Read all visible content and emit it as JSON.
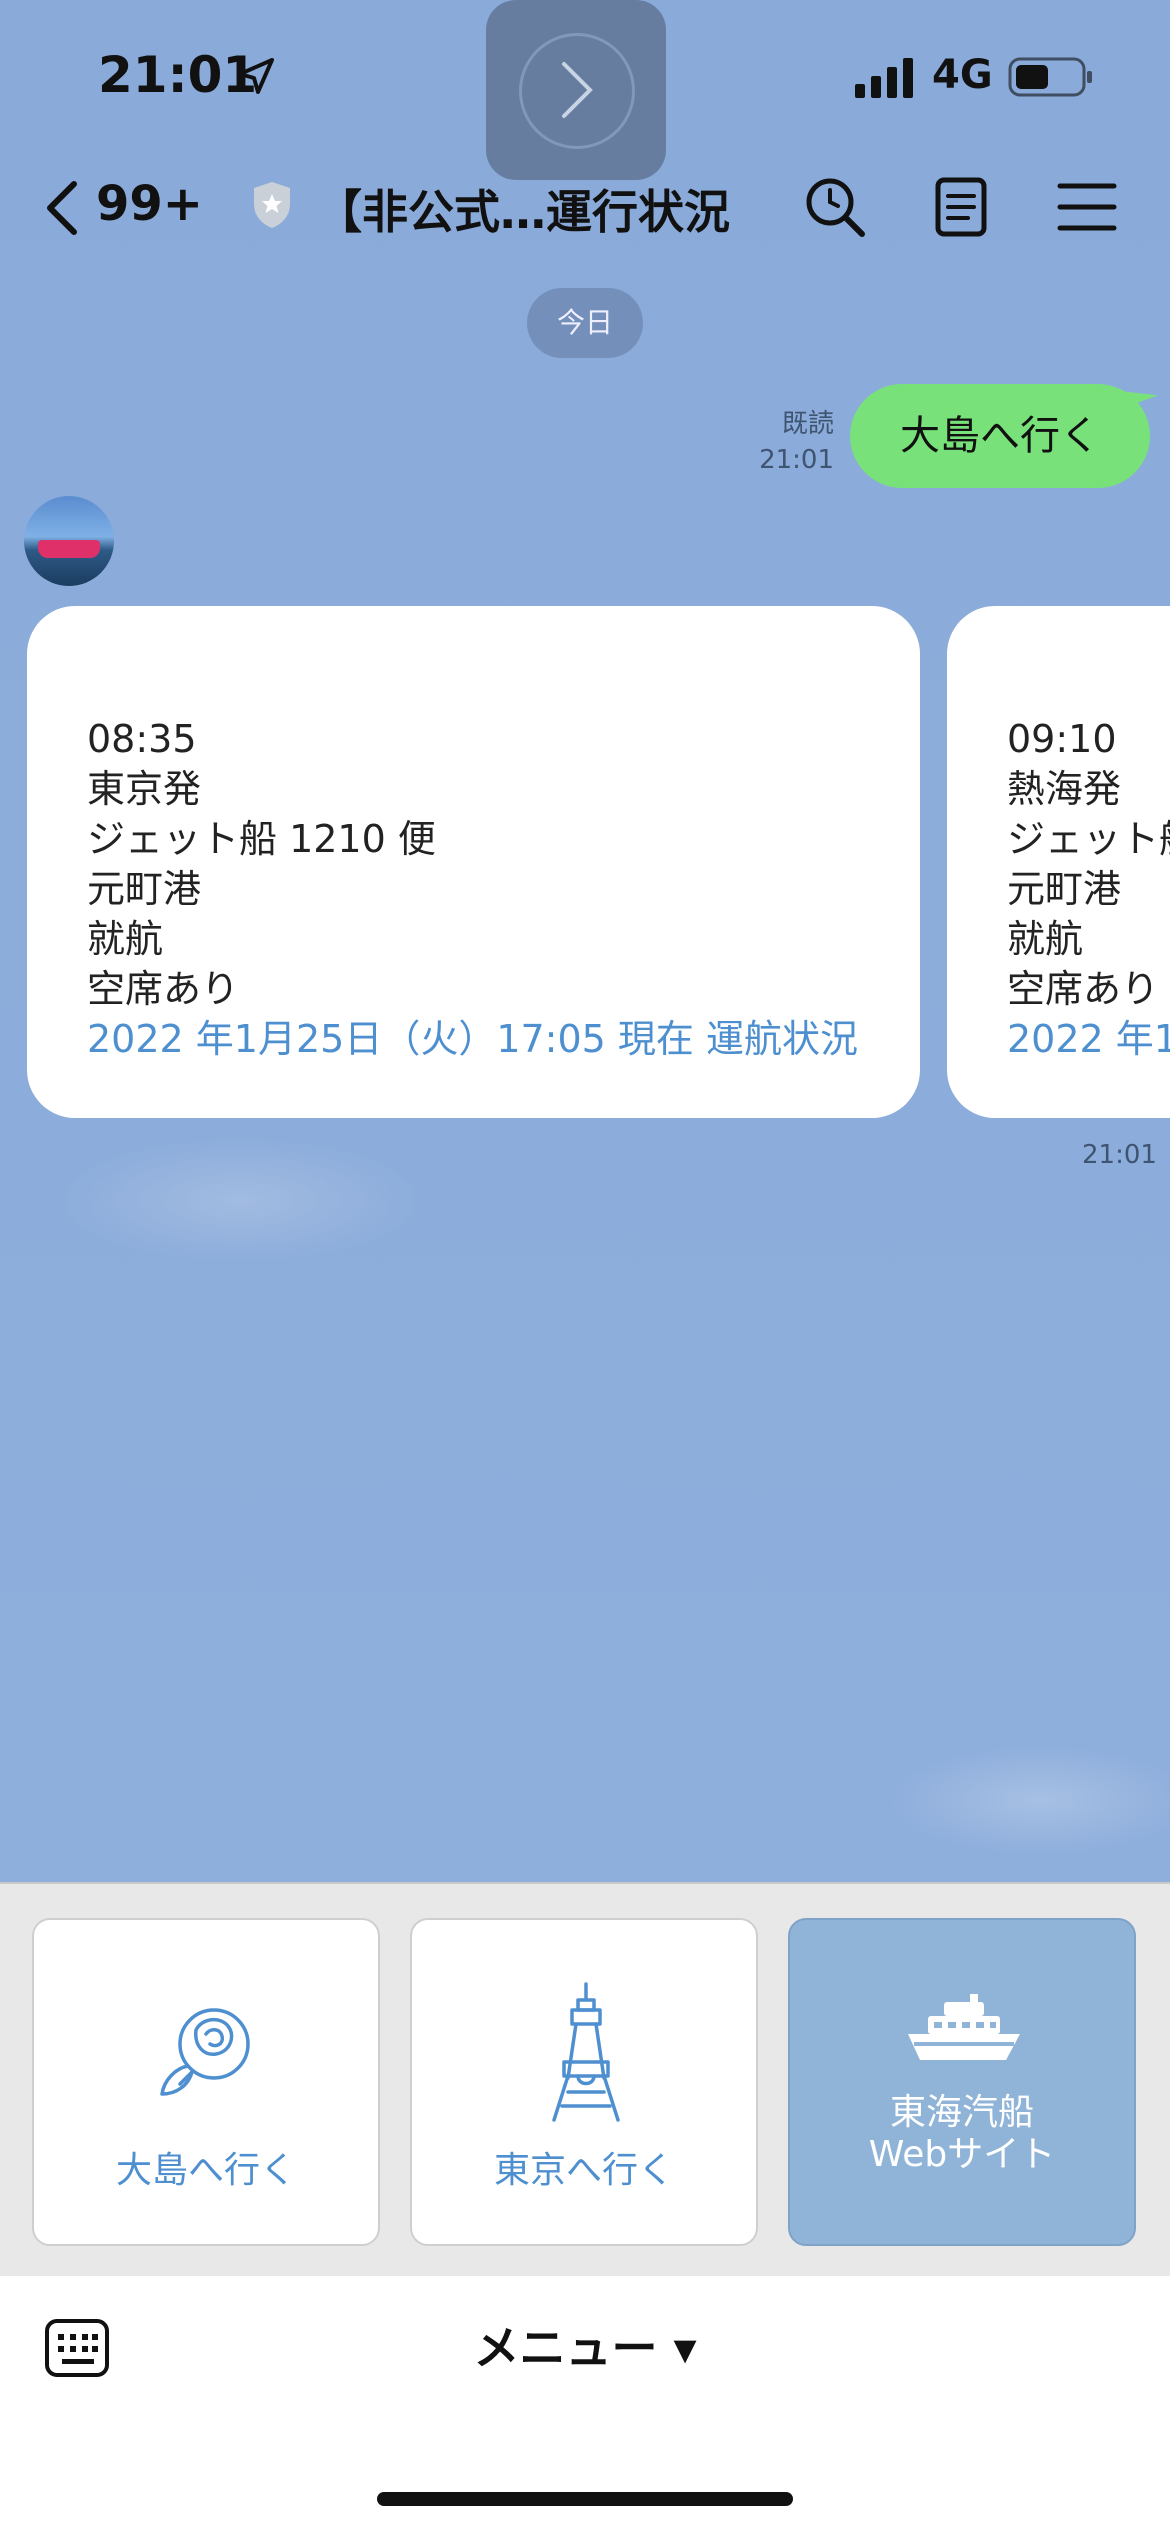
{
  "status_bar": {
    "time": "21:01",
    "network": "4G"
  },
  "header": {
    "back_count": "99+",
    "title": "【非公式…運行状況"
  },
  "chat": {
    "day_label": "今日",
    "outgoing": {
      "read_label": "既読",
      "time": "21:01",
      "text": "大島へ行く"
    },
    "cards": [
      {
        "time": "08:35",
        "origin": "東京発",
        "vessel": "ジェット船 1210 便",
        "port": "元町港",
        "status": "就航",
        "seats": "空席あり",
        "link": "2022 年1月25日（火）17:05 現在 運航状況"
      },
      {
        "time": "09:10",
        "origin": "熱海発",
        "vessel": "ジェット船",
        "port": "元町港",
        "status": "就航",
        "seats": "空席あり",
        "link": "2022 年1月"
      }
    ],
    "incoming_time": "21:01"
  },
  "rich_menu": {
    "tiles": [
      {
        "label": "大島へ行く",
        "icon": "camellia-flower-icon"
      },
      {
        "label": "東京へ行く",
        "icon": "tokyo-tower-icon"
      },
      {
        "label_line1": "東海汽船",
        "label_line2": "Webサイト",
        "icon": "ship-icon"
      }
    ]
  },
  "bottom_bar": {
    "menu_label": "メニュー ▾"
  },
  "colors": {
    "chat_bg": "#8eaedb",
    "outgoing_bubble": "#79e17a",
    "link": "#4e8fd0",
    "tile_active": "#90b4d8"
  }
}
